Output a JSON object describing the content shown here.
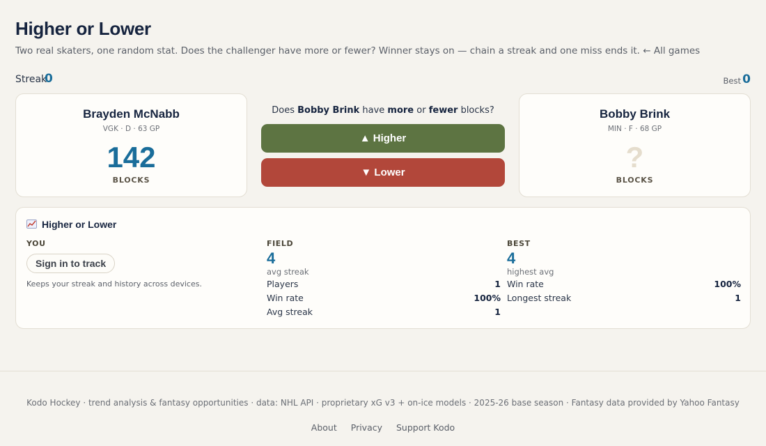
{
  "page": {
    "title": "Higher or Lower",
    "subtitle": "Two real skaters, one random stat. Does the challenger have more or fewer? Winner stays on — chain a streak and one miss ends it.",
    "all_games_link": "← All games"
  },
  "streak": {
    "label": "Streak",
    "value": "0",
    "best_label": "Best",
    "best_value": "0"
  },
  "left_player": {
    "name": "Brayden McNabb",
    "meta": "VGK · D · 63 GP",
    "stat_value": "142",
    "stat_name": "BLOCKS"
  },
  "right_player": {
    "name": "Bobby Brink",
    "meta": "MIN · F · 68 GP",
    "stat_value": "?",
    "stat_name": "BLOCKS"
  },
  "question": {
    "prefix": "Does ",
    "player": "Bobby Brink",
    "mid": " have ",
    "more": "more",
    "or": " or ",
    "fewer": "fewer",
    "suffix": " blocks?"
  },
  "buttons": {
    "higher": "▲ Higher",
    "lower": "▼ Lower"
  },
  "stats_panel": {
    "title": "Higher or Lower",
    "you": {
      "heading": "YOU",
      "signin_label": "Sign in to track",
      "note": "Keeps your streak and history across devices."
    },
    "field": {
      "heading": "FIELD",
      "big_value": "4",
      "big_label": "avg streak",
      "rows": [
        {
          "label": "Players",
          "value": "1"
        },
        {
          "label": "Win rate",
          "value": "100%"
        },
        {
          "label": "Avg streak",
          "value": "1"
        }
      ]
    },
    "best": {
      "heading": "BEST",
      "big_value": "4",
      "big_label": "highest avg",
      "rows": [
        {
          "label": "Win rate",
          "value": "100%"
        },
        {
          "label": "Longest streak",
          "value": "1"
        }
      ]
    }
  },
  "footer": {
    "text": "Kodo Hockey · trend analysis & fantasy opportunities · data: NHL API · proprietary xG v3 + on-ice models · 2025-26 base season · Fantasy data provided by Yahoo Fantasy",
    "links": [
      "About",
      "Privacy",
      "Support Kodo"
    ]
  },
  "colors": {
    "accent": "#1a6d9a",
    "higher": "#5d7442",
    "lower": "#b2473a",
    "background": "#f5f3ee"
  }
}
